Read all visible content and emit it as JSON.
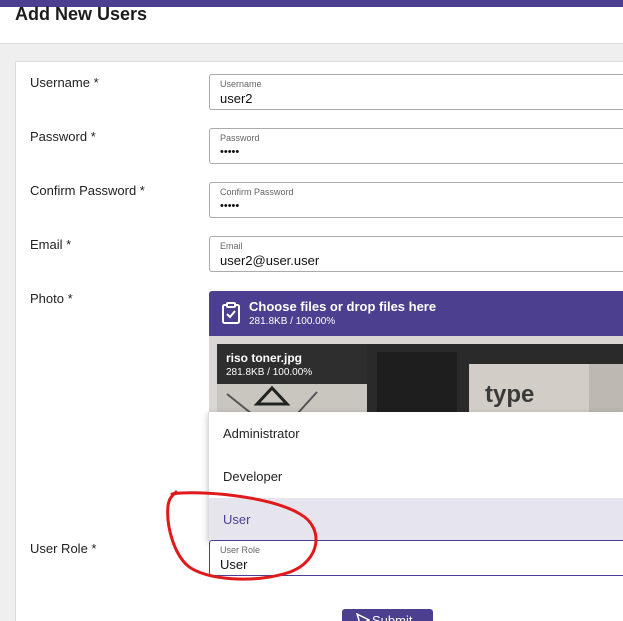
{
  "page": {
    "title": "Add New Users"
  },
  "form": {
    "username": {
      "label": "Username *",
      "float_label": "Username",
      "value": "user2"
    },
    "password": {
      "label": "Password *",
      "float_label": "Password",
      "value": "•••••"
    },
    "confirm_password": {
      "label": "Confirm Password *",
      "float_label": "Confirm Password",
      "value": "•••••"
    },
    "email": {
      "label": "Email *",
      "float_label": "Email",
      "value": "user2@user.user"
    },
    "photo": {
      "label": "Photo *",
      "upload_prompt": "Choose files or drop files here",
      "upload_status": "281.8KB / 100.00%",
      "file_name": "riso toner.jpg",
      "file_status": "281.8KB / 100.00%",
      "image_text": "type"
    },
    "user_role": {
      "label": "User Role *",
      "float_label": "User Role",
      "value": "User",
      "options": [
        "Administrator",
        "Developer",
        "User"
      ],
      "selected_index": 2
    }
  },
  "actions": {
    "submit_label": "Submit"
  },
  "colors": {
    "accent": "#4d3f8f",
    "annotation": "#e0191b"
  },
  "icons": {
    "upload": "clipboard-check-icon",
    "submit": "send-icon"
  }
}
